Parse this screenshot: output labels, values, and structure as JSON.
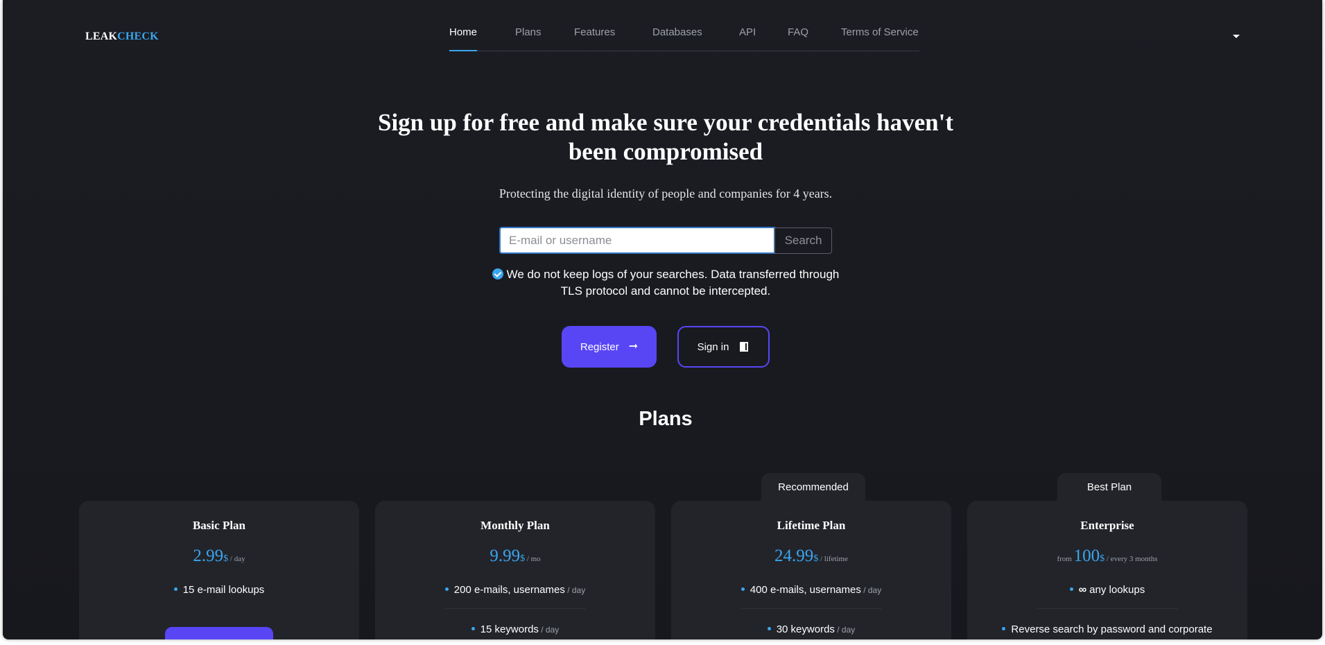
{
  "logo": {
    "part1": "LEAK",
    "part2": "CHECK"
  },
  "nav": {
    "items": [
      {
        "label": "Home",
        "active": true
      },
      {
        "label": "Plans"
      },
      {
        "label": "Features"
      },
      {
        "label": "Databases"
      },
      {
        "label": "API"
      },
      {
        "label": "FAQ"
      },
      {
        "label": "Terms of Service"
      }
    ],
    "icon": "chevron-down-icon"
  },
  "hero": {
    "title": "Sign up for free and make sure your credentials haven't been compromised",
    "subtitle": "Protecting the digital identity of people and companies for 4 years."
  },
  "search": {
    "placeholder": "E-mail or username",
    "value": "",
    "button_label": "Search"
  },
  "notice": {
    "icon": "check-circle-icon",
    "text": "We do not keep logs of your searches. Data transferred through TLS protocol and cannot be intercepted."
  },
  "actions": {
    "register_label": "Register",
    "register_icon": "arrow-right-icon",
    "signin_label": "Sign in",
    "signin_icon": "door-icon"
  },
  "plans": {
    "title": "Plans",
    "cards": [
      {
        "title": "Basic Plan",
        "price": "2.99",
        "currency": "$",
        "period": " / day",
        "features": [
          {
            "text": "15 e-mail lookups",
            "unit": ""
          }
        ]
      },
      {
        "title": "Monthly Plan",
        "price": "9.99",
        "currency": "$",
        "period": " / mo",
        "features": [
          {
            "text": "200 e-mails, usernames",
            "unit": " / day"
          },
          {
            "text": "15 keywords",
            "unit": " / day"
          }
        ]
      },
      {
        "title": "Lifetime Plan",
        "badge": "Recommended",
        "price": "24.99",
        "currency": "$",
        "period": " / lifetime",
        "features": [
          {
            "text": "400 e-mails, usernames",
            "unit": " / day"
          },
          {
            "text": "30 keywords",
            "unit": " / day"
          }
        ]
      },
      {
        "title": "Enterprise",
        "badge": "Best Plan",
        "prefix": "from ",
        "price": "100",
        "currency": "$",
        "period": " / every 3 months",
        "features": [
          {
            "text": "any lookups",
            "unit": "",
            "icon": "infinity-icon",
            "icon_glyph": "∞"
          },
          {
            "text": "Reverse search by password and corporate",
            "unit": ""
          }
        ]
      }
    ]
  },
  "colors": {
    "accent": "#3aa6ef",
    "primary": "#5846f5",
    "background": "#1b1d23",
    "card": "#22242a"
  }
}
